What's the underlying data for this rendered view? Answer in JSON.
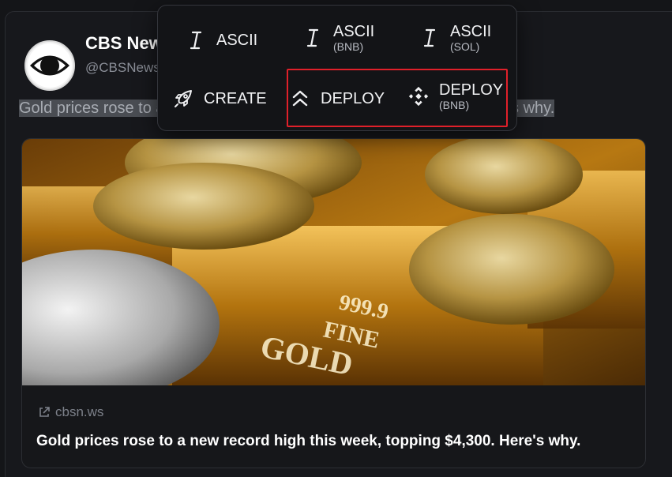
{
  "tweet": {
    "author_name": "CBS News",
    "author_handle": "@CBSNews",
    "text": "Gold prices rose to a new record high this week, topping $4,300. Here's why."
  },
  "preview": {
    "domain": "cbsn.ws",
    "title": "Gold prices rose to a new record high this week, topping $4,300. Here's why.",
    "image_alt": "Gold bars and coins"
  },
  "popup": {
    "items": [
      {
        "label": "ASCII",
        "sub": "",
        "icon": "text-cursor-icon"
      },
      {
        "label": "ASCII",
        "sub": "(BNB)",
        "icon": "text-cursor-icon"
      },
      {
        "label": "ASCII",
        "sub": "(SOL)",
        "icon": "text-cursor-icon"
      },
      {
        "label": "CREATE",
        "sub": "",
        "icon": "rocket-icon"
      },
      {
        "label": "DEPLOY",
        "sub": "",
        "icon": "double-chevron-up-icon"
      },
      {
        "label": "DEPLOY",
        "sub": "(BNB)",
        "icon": "bnb-logo-icon"
      }
    ]
  },
  "colors": {
    "background": "#141518",
    "highlight": "#e0202a",
    "gold": "#c8961e"
  }
}
